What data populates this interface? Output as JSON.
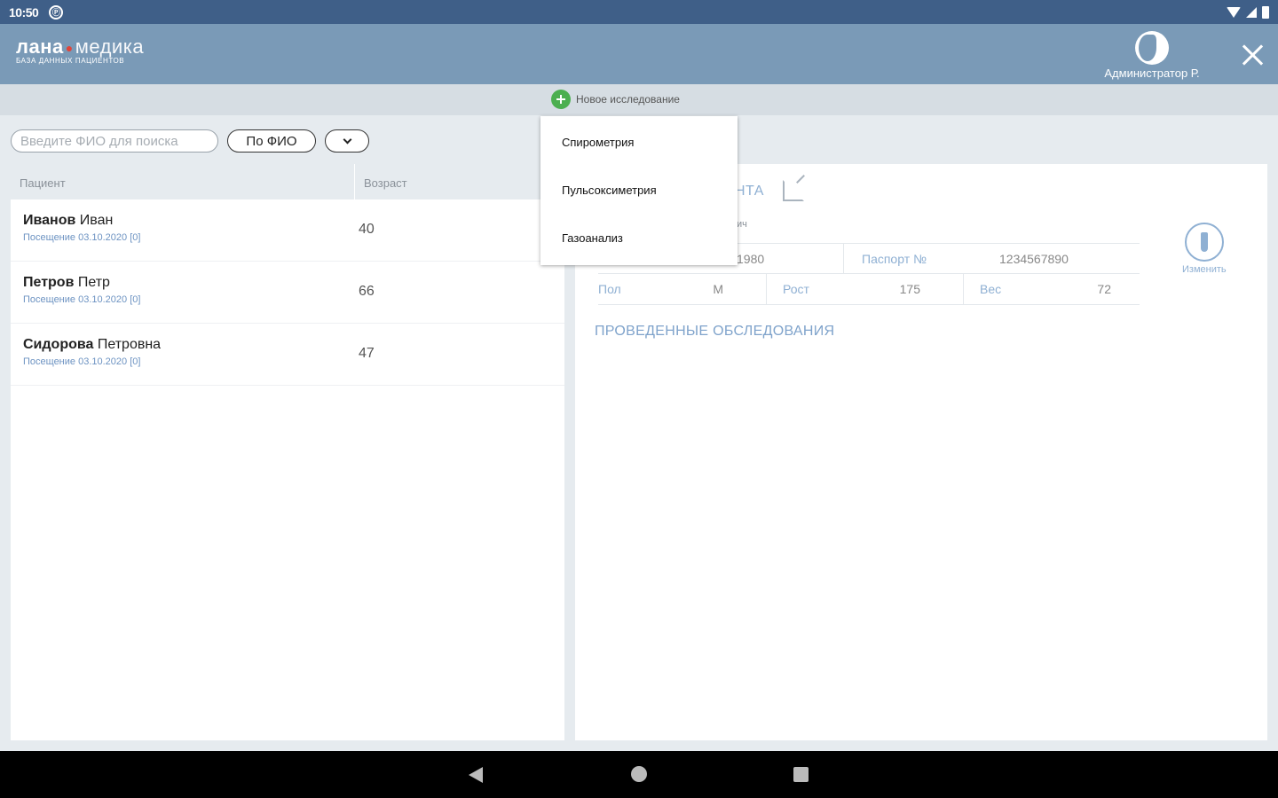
{
  "status_bar": {
    "time": "10:50",
    "notif_icon": "app-notification-icon"
  },
  "app": {
    "logo_bold": "лана",
    "logo_thin": "медика",
    "logo_sub": "база данных пациентов",
    "user_name": "Администратор Р."
  },
  "toolbar": {
    "new_exam_label": "Новое исследование"
  },
  "search": {
    "placeholder": "Введите ФИО для поиска",
    "mode_label": "По ФИО"
  },
  "patients": {
    "headers": {
      "patient": "Пациент",
      "age": "Возраст"
    },
    "rows": [
      {
        "surname": "Иванов",
        "name": "Иван",
        "visit": "Посещение 03.10.2020 [0]",
        "age": "40"
      },
      {
        "surname": "Петров",
        "name": "Петр",
        "visit": "Посещение 03.10.2020 [0]",
        "age": "66"
      },
      {
        "surname": "Сидорова",
        "name": "Петровна",
        "visit": "Посещение 03.10.2020 [0]",
        "age": "47"
      }
    ]
  },
  "card": {
    "title_fragment": "НТА",
    "subtitle_fragment": "ич",
    "dob_fragment": "1980",
    "passport_label": "Паспорт №",
    "passport_value": "1234567890",
    "sex_label": "Пол",
    "sex_value": "М",
    "height_label": "Рост",
    "height_value": "175",
    "weight_label": "Вес",
    "weight_value": "72",
    "change_label": "Изменить",
    "exams_title": "ПРОВЕДЕННЫЕ ОБСЛЕДОВАНИЯ"
  },
  "menu": {
    "items": [
      "Спирометрия",
      "Пульсоксиметрия",
      "Газоанализ"
    ]
  }
}
